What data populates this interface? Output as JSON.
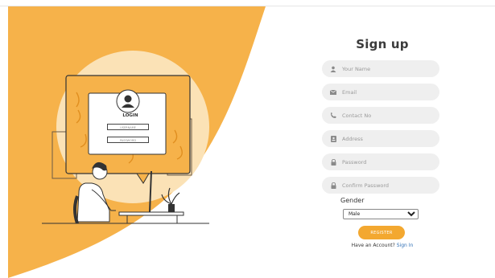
{
  "illustration": {
    "login_title": "LOGIN",
    "username_placeholder": "USERNAME",
    "password_placeholder": "PASSWORD",
    "accent_color": "#f6b24a"
  },
  "form": {
    "title": "Sign up",
    "fields": [
      {
        "icon": "user-icon",
        "placeholder": "Your Name"
      },
      {
        "icon": "envelope-icon",
        "placeholder": "Email"
      },
      {
        "icon": "phone-icon",
        "placeholder": "Contact No"
      },
      {
        "icon": "address-card-icon",
        "placeholder": "Address"
      },
      {
        "icon": "lock-icon",
        "placeholder": "Password"
      },
      {
        "icon": "lock-icon",
        "placeholder": "Confirm Password"
      }
    ],
    "gender_label": "Gender",
    "gender_value": "Male",
    "register_label": "REGISTER",
    "have_account_text": "Have an Account?",
    "sign_in_label": "Sign In",
    "button_color": "#f3a830",
    "field_bg": "#efefef"
  }
}
